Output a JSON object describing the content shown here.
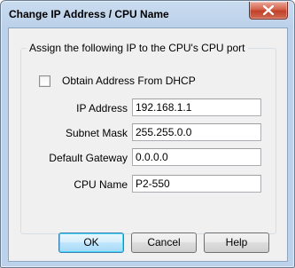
{
  "dialog": {
    "title": "Change IP Address / CPU Name"
  },
  "group": {
    "legend": "Assign the following IP to the CPU's CPU port"
  },
  "dhcp": {
    "label": "Obtain Address From DHCP",
    "checked": false
  },
  "fields": {
    "ip_address": {
      "label": "IP Address",
      "value": "192.168.1.1"
    },
    "subnet_mask": {
      "label": "Subnet Mask",
      "value": "255.255.0.0"
    },
    "default_gateway": {
      "label": "Default Gateway",
      "value": "0.0.0.0"
    },
    "cpu_name": {
      "label": "CPU Name",
      "value": "P2-550"
    }
  },
  "buttons": {
    "ok": "OK",
    "cancel": "Cancel",
    "help": "Help"
  },
  "icons": {
    "close": "close-icon"
  },
  "colors": {
    "close_button": "#c2412a",
    "title_bar": "#bcd1ea",
    "client_background": "#f0f0f0",
    "default_button_border": "#3c7fb1"
  }
}
